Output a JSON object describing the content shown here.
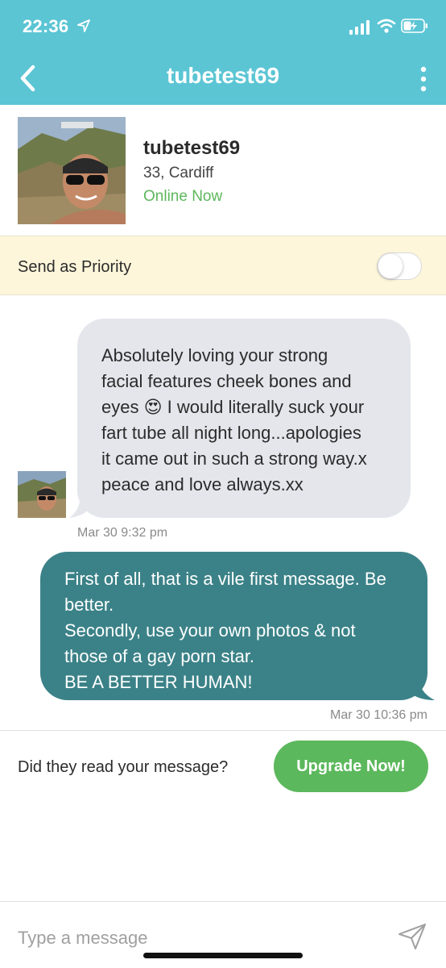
{
  "status_bar": {
    "time": "22:36",
    "location_icon": "location-arrow-icon",
    "signal_icon": "cellular-signal-icon",
    "wifi_icon": "wifi-icon",
    "battery_icon": "battery-charging-icon"
  },
  "header": {
    "title": "tubetest69",
    "back_icon": "chevron-left-icon",
    "menu_icon": "more-vertical-icon",
    "background_color": "#5bc5d4"
  },
  "profile": {
    "name": "tubetest69",
    "meta": "33, Cardiff",
    "online_status": "Online Now",
    "online_color": "#5cb85c"
  },
  "priority": {
    "label": "Send as Priority",
    "toggle_on": false
  },
  "messages": [
    {
      "direction": "incoming",
      "lines": [
        "Absolutely loving your strong",
        "facial features cheek bones and",
        "eyes",
        "😍",
        "I would literally suck your",
        "fart tube all night long...apologies",
        "it came out in such a strong way.x",
        "peace and love always.xx"
      ],
      "timestamp": "Mar 30 9:32 pm"
    },
    {
      "direction": "outgoing",
      "lines": [
        "First of all, that is a vile first message. Be",
        "better.",
        "Secondly, use your own photos & not",
        "those of a gay porn star.",
        "BE A BETTER HUMAN!"
      ],
      "timestamp": "Mar 30 10:36 pm",
      "bubble_color": "#3b8288"
    }
  ],
  "read_receipt": {
    "label": "Did they read your message?",
    "button_label": "Upgrade Now!"
  },
  "composer": {
    "placeholder": "Type a message",
    "send_icon": "send-paper-plane-icon"
  }
}
